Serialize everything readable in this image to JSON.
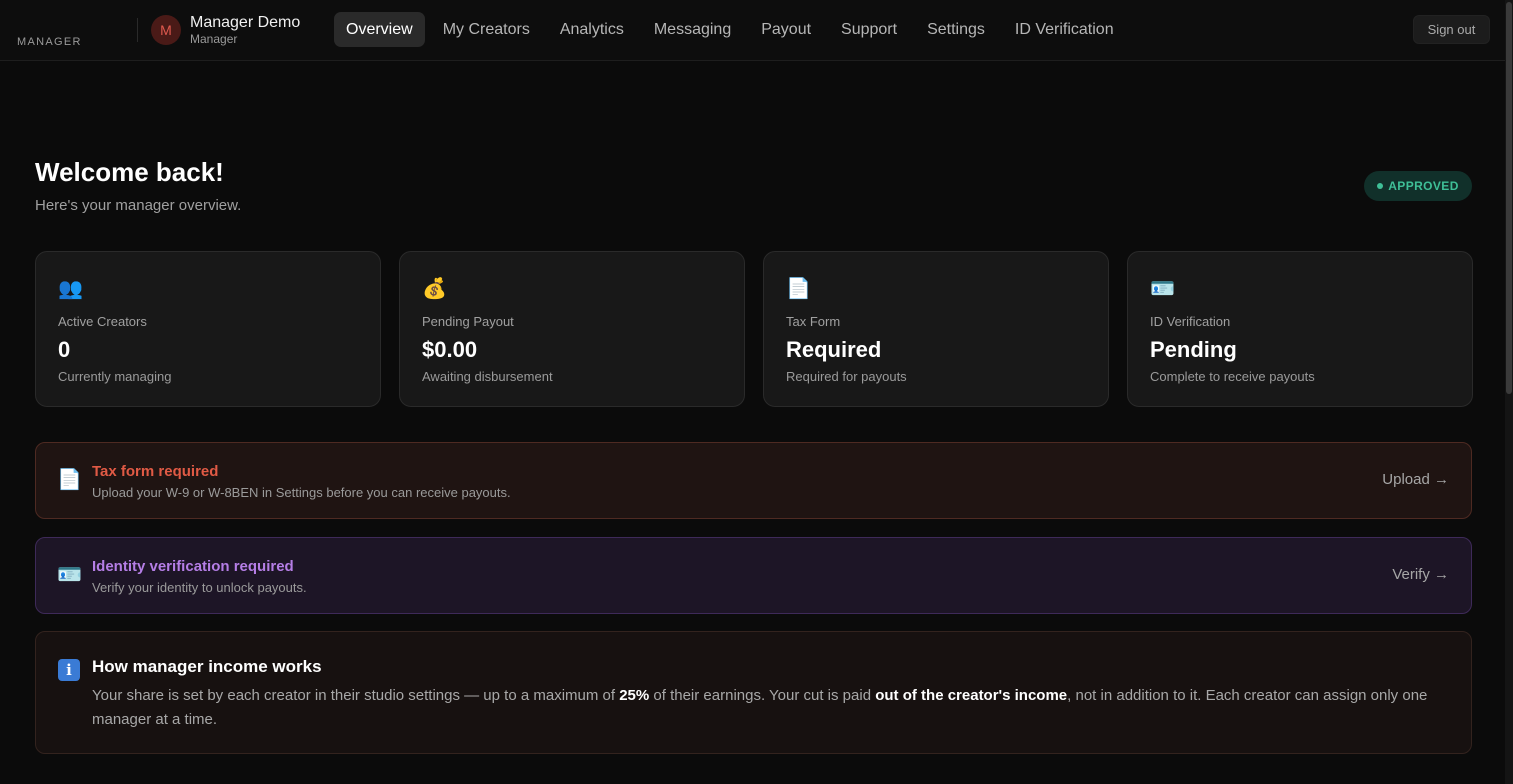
{
  "header": {
    "brand": "MANAGER",
    "avatar_initial": "M",
    "user_name": "Manager Demo",
    "user_role": "Manager",
    "nav": [
      {
        "label": "Overview",
        "active": true
      },
      {
        "label": "My Creators",
        "active": false
      },
      {
        "label": "Analytics",
        "active": false
      },
      {
        "label": "Messaging",
        "active": false
      },
      {
        "label": "Payout",
        "active": false
      },
      {
        "label": "Support",
        "active": false
      },
      {
        "label": "Settings",
        "active": false
      },
      {
        "label": "ID Verification",
        "active": false
      }
    ],
    "sign_out": "Sign out"
  },
  "main": {
    "title": "Welcome back!",
    "subtitle": "Here's your manager overview.",
    "status_badge": "APPROVED",
    "status_color": "#3fbf97",
    "cards": [
      {
        "icon": "people-icon",
        "glyph": "👥",
        "label": "Active Creators",
        "value": "0",
        "note": "Currently managing"
      },
      {
        "icon": "money-bag-icon",
        "glyph": "💰",
        "label": "Pending Payout",
        "value": "$0.00",
        "note": "Awaiting disbursement"
      },
      {
        "icon": "document-icon",
        "glyph": "📄",
        "label": "Tax Form",
        "value": "Required",
        "note": "Required for payouts"
      },
      {
        "icon": "id-card-icon",
        "glyph": "🪪",
        "label": "ID Verification",
        "value": "Pending",
        "note": "Complete to receive payouts"
      }
    ],
    "alerts": {
      "tax": {
        "icon": "document-icon",
        "glyph": "📄",
        "title": "Tax form required",
        "text": "Upload your W-9 or W-8BEN in Settings before you can receive payouts.",
        "action": "Upload →",
        "color": "#e05a45"
      },
      "id": {
        "icon": "id-card-icon",
        "glyph": "🪪",
        "title": "Identity verification required",
        "text": "Verify your identity to unlock payouts.",
        "action": "Verify →",
        "color": "#b57ee6"
      }
    },
    "info": {
      "icon": "info-icon",
      "glyph": "i",
      "title": "How manager income works",
      "text_1": "Your share is set by each creator in their studio settings — up to a maximum of ",
      "bold_1": "25%",
      "text_2": " of their earnings. Your cut is paid ",
      "bold_2": "out of the creator's income",
      "text_3": ", not in addition to it. Each creator can assign only one manager at a time."
    }
  }
}
